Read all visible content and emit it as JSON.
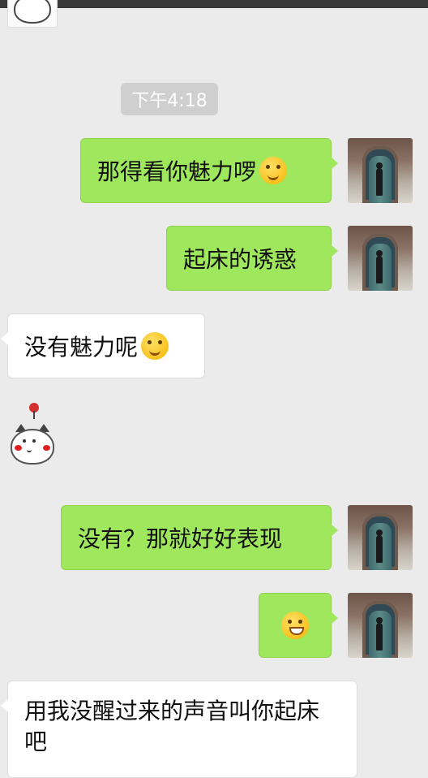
{
  "chat": {
    "timestamp": "下午4:18",
    "messages": [
      {
        "side": "right",
        "text": "那得看你魅力啰",
        "emoji": "smirk-emoji"
      },
      {
        "side": "right",
        "text": "起床的诱惑"
      },
      {
        "side": "left",
        "text": "没有魅力呢",
        "emoji": "blush-emoji"
      },
      {
        "side": "left",
        "sticker": "cat-sticker"
      },
      {
        "side": "right",
        "text": "没有？那就好好表现"
      },
      {
        "side": "right",
        "emoji": "grin-emoji"
      },
      {
        "side": "left",
        "text": "用我没醒过来的声音叫你起床吧"
      }
    ]
  },
  "colors": {
    "sent_bubble": "#9fe75c",
    "received_bubble": "#ffffff",
    "background": "#ebebeb"
  }
}
